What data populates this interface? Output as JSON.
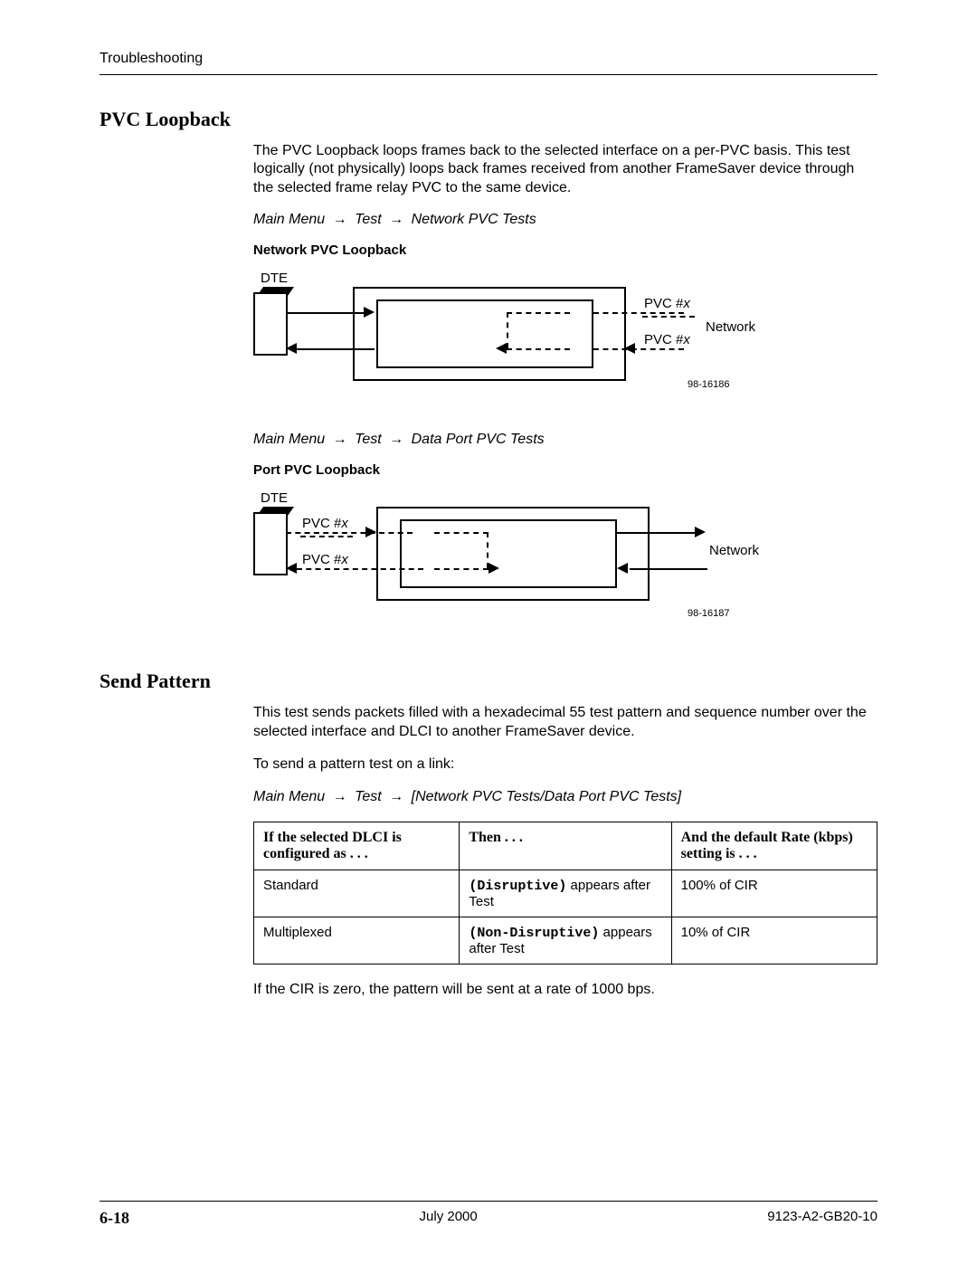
{
  "header": {
    "running_head": "Troubleshooting"
  },
  "section1": {
    "title": "PVC Loopback",
    "para": "The PVC Loopback loops frames back to the selected interface on a per-PVC basis. This test logically (not physically) loops back frames received from another FrameSaver device through the selected frame relay PVC to the same device.",
    "nav1_a": "Main Menu",
    "nav1_b": "Test",
    "nav1_c": "Network PVC Tests",
    "fig1_title": "Network PVC Loopback",
    "fig1": {
      "dte": "DTE",
      "pvcx_top": "PVC #",
      "pvcx_top_x": "x",
      "pvcx_bot": "PVC #",
      "pvcx_bot_x": "x",
      "network": "Network",
      "code": "98-16186"
    },
    "nav2_a": "Main Menu",
    "nav2_b": "Test",
    "nav2_c": "Data Port PVC Tests",
    "fig2_title": "Port PVC Loopback",
    "fig2": {
      "dte": "DTE",
      "pvcx_top": "PVC #",
      "pvcx_top_x": "x",
      "pvcx_bot": "PVC #",
      "pvcx_bot_x": "x",
      "network": "Network",
      "code": "98-16187"
    }
  },
  "section2": {
    "title": "Send Pattern",
    "para1": "This test sends packets filled with a hexadecimal 55 test pattern and sequence number over the selected interface and DLCI to another FrameSaver device.",
    "para2": "To send a pattern test on a link:",
    "nav_a": "Main Menu",
    "nav_b": "Test",
    "nav_c": "[Network PVC Tests/Data Port PVC Tests]",
    "table": {
      "head": {
        "c1": "If the selected DLCI is configured as . . .",
        "c2": "Then . . .",
        "c3": "And the default Rate (kbps) setting is . . ."
      },
      "rows": [
        {
          "c1": "Standard",
          "c2_mono": "(Disruptive)",
          "c2_rest": " appears after Test",
          "c3": "100% of CIR"
        },
        {
          "c1": "Multiplexed",
          "c2_mono": "(Non-Disruptive)",
          "c2_rest": " appears after Test",
          "c3": "10% of CIR"
        }
      ]
    },
    "para3": "If the CIR is zero, the pattern will be sent at a rate of 1000 bps."
  },
  "footer": {
    "page": "6-18",
    "date": "July 2000",
    "doc": "9123-A2-GB20-10"
  },
  "glyphs": {
    "arrow": "→"
  }
}
